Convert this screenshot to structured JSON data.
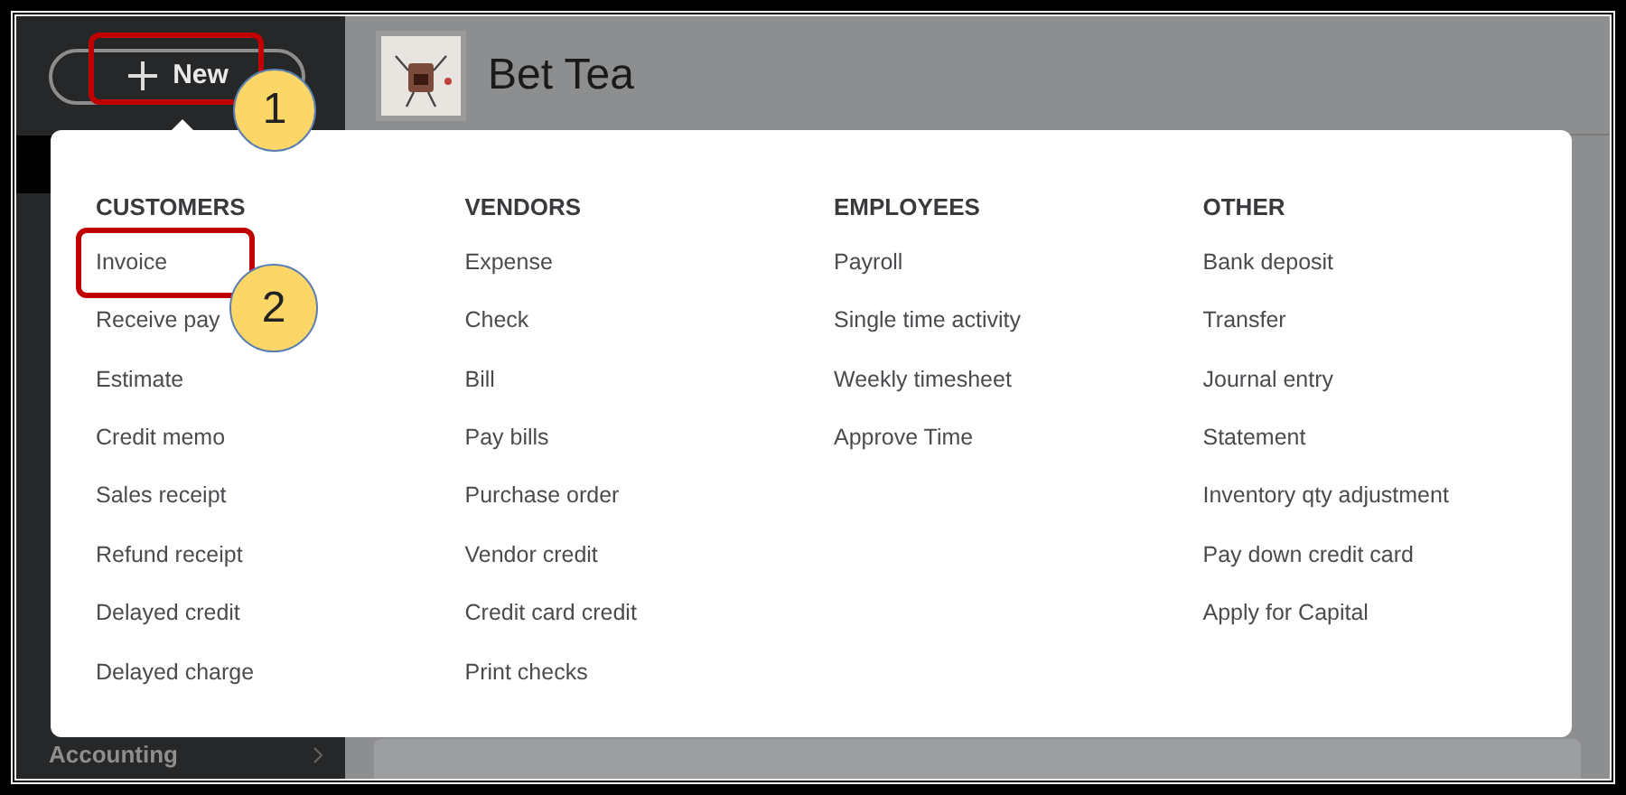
{
  "new_button": {
    "label": "New"
  },
  "company": {
    "name": "Bet Tea"
  },
  "sidebar": {
    "items": [
      {
        "label": "Accounting"
      }
    ]
  },
  "menu": {
    "columns": [
      {
        "heading": "CUSTOMERS",
        "items": [
          "Invoice",
          "Receive pay",
          "Estimate",
          "Credit memo",
          "Sales receipt",
          "Refund receipt",
          "Delayed credit",
          "Delayed charge"
        ]
      },
      {
        "heading": "VENDORS",
        "items": [
          "Expense",
          "Check",
          "Bill",
          "Pay bills",
          "Purchase order",
          "Vendor credit",
          "Credit card credit",
          "Print checks"
        ]
      },
      {
        "heading": "EMPLOYEES",
        "items": [
          "Payroll",
          "Single time activity",
          "Weekly timesheet",
          "Approve Time"
        ]
      },
      {
        "heading": "OTHER",
        "items": [
          "Bank deposit",
          "Transfer",
          "Journal entry",
          "Statement",
          "Inventory qty adjustment",
          "Pay down credit card",
          "Apply for Capital"
        ]
      }
    ]
  },
  "callouts": [
    {
      "label": "1"
    },
    {
      "label": "2"
    }
  ]
}
